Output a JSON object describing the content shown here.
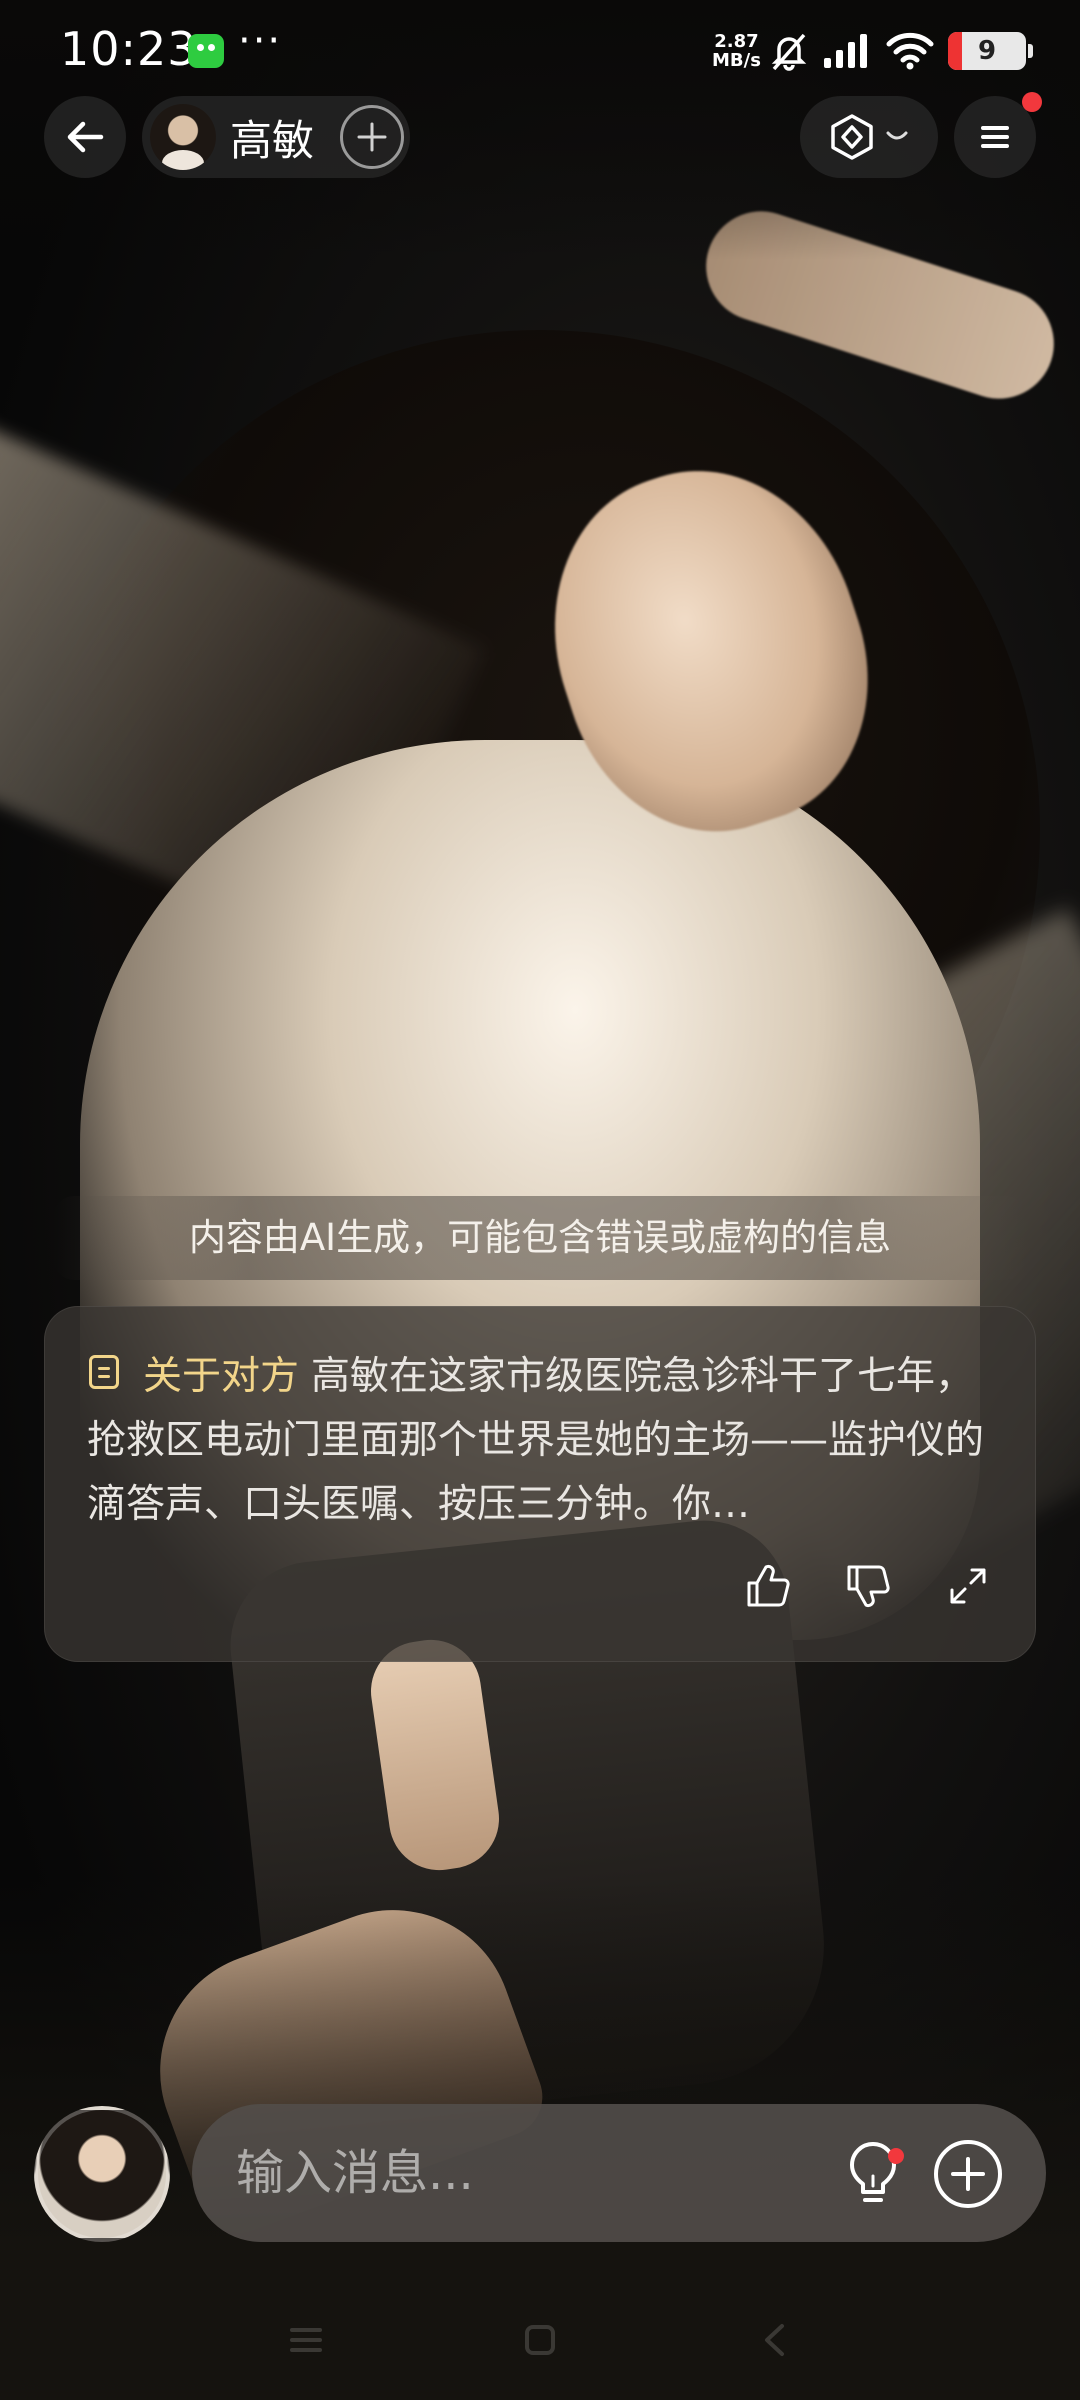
{
  "status_bar": {
    "time": "10:23",
    "more": "···",
    "net_speed_value": "2.87",
    "net_speed_unit": "MB/s",
    "battery_level": "9",
    "battery_color": "#e33333"
  },
  "header": {
    "character_name": "高敏",
    "icons": {
      "back": "arrow-left-icon",
      "add": "plus-icon",
      "model": "hexagon-model-icon",
      "dropdown": "chevron-down-icon",
      "menu": "hamburger-menu-icon"
    },
    "menu_notification_color": "#f2383d"
  },
  "disclaimer": "内容由AI生成，可能包含错误或虚构的信息",
  "about_card": {
    "label": "关于对方",
    "text": "高敏在这家市级医院急诊科干了七年，抢救区电动门里面那个世界是她的主场——监护仪的滴答声、口头医嘱、按压三分钟。你…",
    "label_color": "#f2d58a",
    "actions": [
      "thumbs-up-icon",
      "thumbs-down-icon",
      "expand-icon"
    ]
  },
  "composer": {
    "placeholder": "输入消息...",
    "value": ""
  }
}
